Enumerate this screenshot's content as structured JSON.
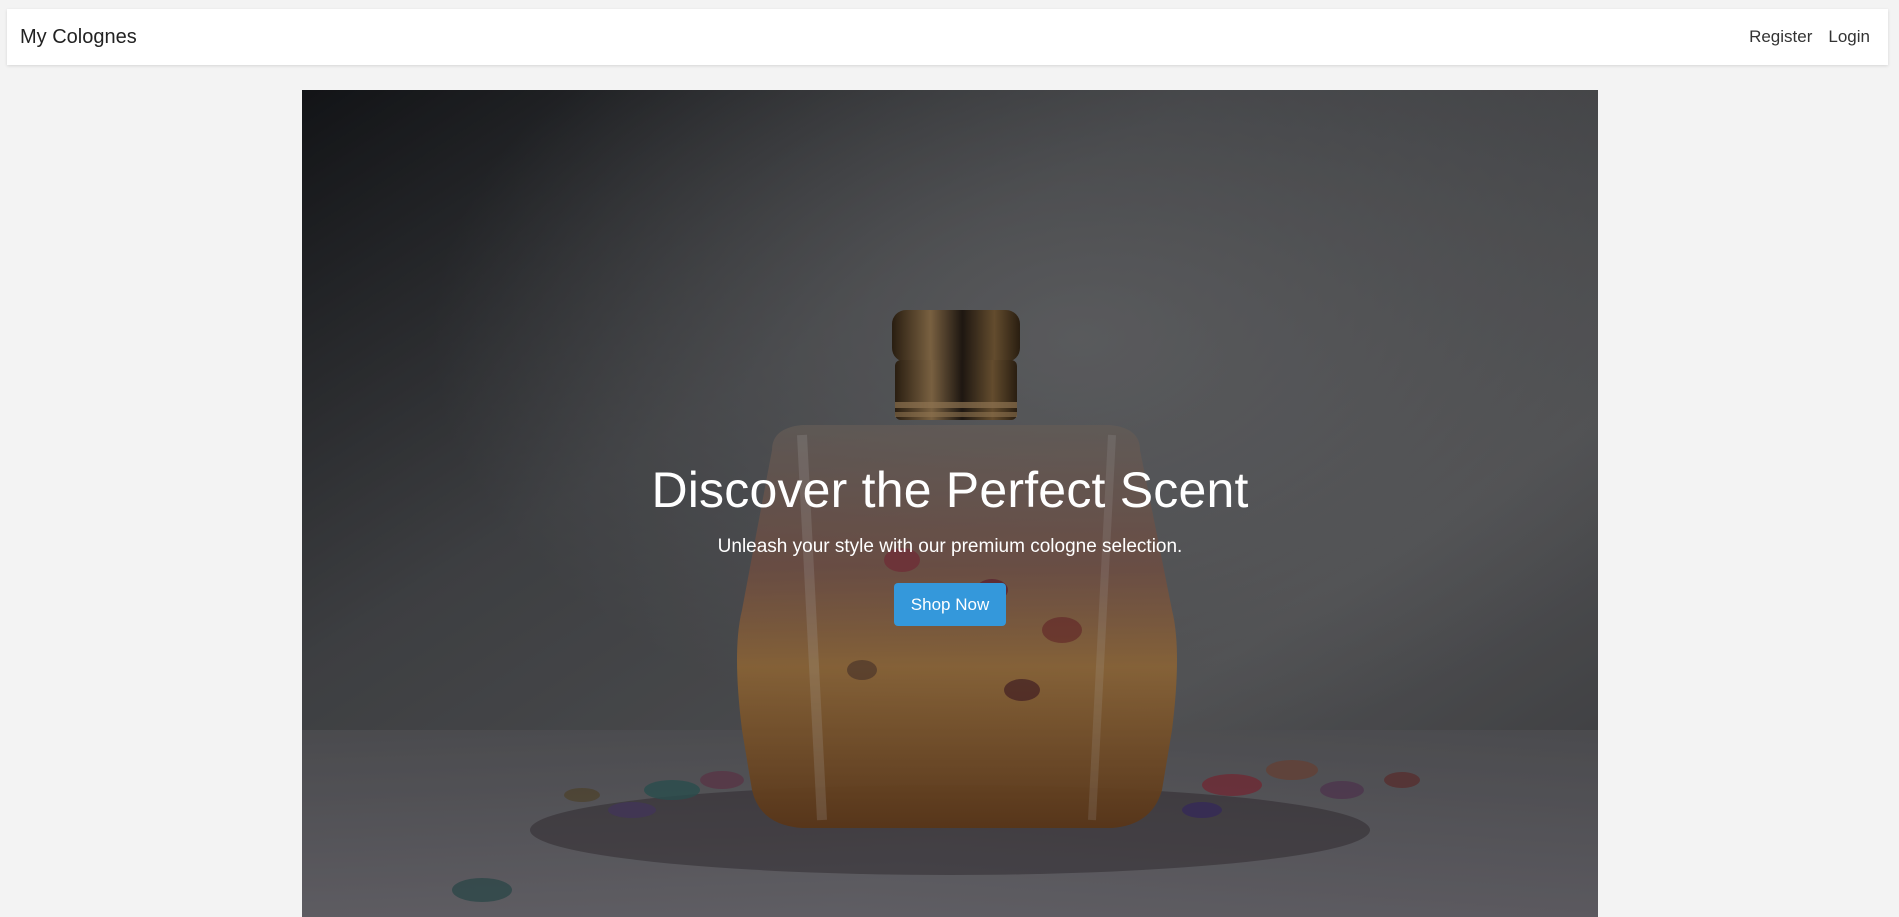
{
  "navbar": {
    "brand": "My Colognes",
    "links": [
      {
        "label": "Register"
      },
      {
        "label": "Login"
      }
    ]
  },
  "hero": {
    "title": "Discover the Perfect Scent",
    "subtitle": "Unleash your style with our premium cologne selection.",
    "cta_label": "Shop Now",
    "image_subject": "cologne-bottle-with-flower-petals"
  },
  "colors": {
    "page_bg": "#f3f3f3",
    "navbar_bg": "#ffffff",
    "cta_bg": "#3498db",
    "hero_text": "#ffffff"
  }
}
